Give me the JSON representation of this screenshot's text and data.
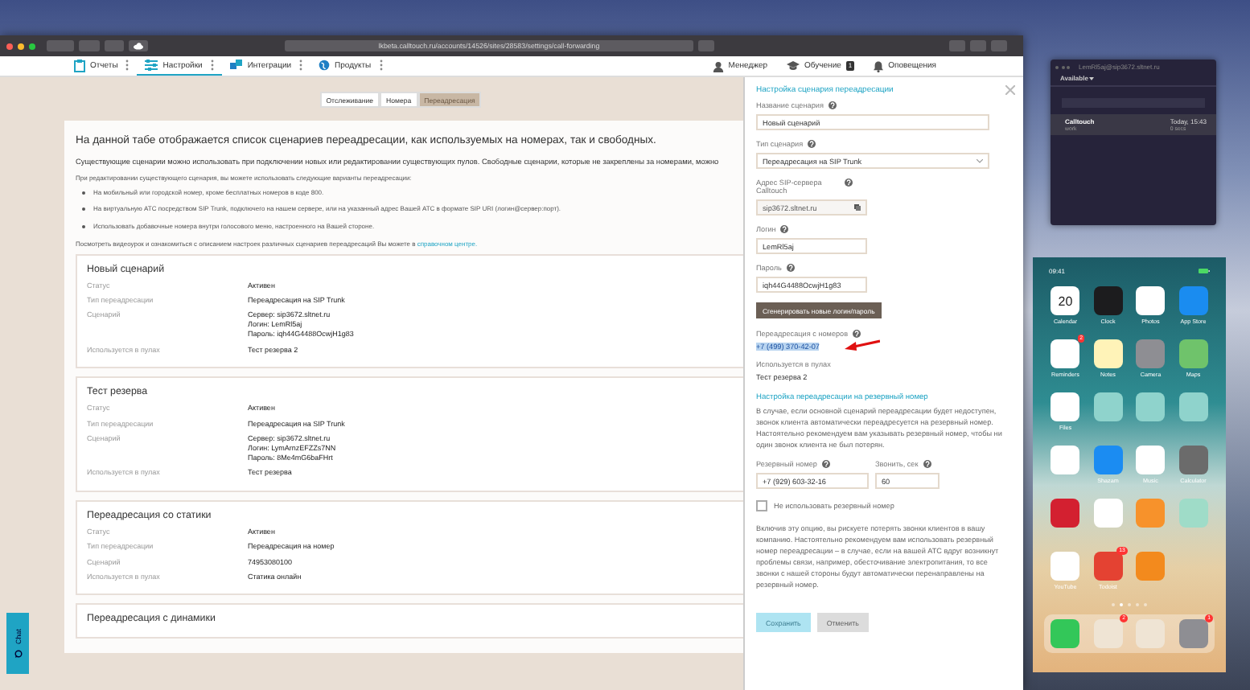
{
  "browser": {
    "url": "lkbeta.calltouch.ru/accounts/14526/sites/28583/settings/call-forwarding"
  },
  "nav": {
    "items": [
      {
        "label": "Отчеты",
        "selected": false
      },
      {
        "label": "Настройки",
        "selected": true
      },
      {
        "label": "Интеграции",
        "selected": false
      },
      {
        "label": "Продукты",
        "selected": false
      }
    ],
    "right": [
      {
        "label": "Менеджер",
        "kind": "manager"
      },
      {
        "label": "Обучение",
        "kind": "learning",
        "badge": "1"
      },
      {
        "label": "Оповещения",
        "kind": "alerts"
      }
    ]
  },
  "subtabs": [
    {
      "label": "Отслеживание",
      "selected": false
    },
    {
      "label": "Номера",
      "selected": false
    },
    {
      "label": "Переадресация",
      "selected": true
    }
  ],
  "intro": {
    "heading": "На данной табе отображается список сценариев переадресации, как используемых на номерах, так и свободных.",
    "paragraph": "Существующие сценарии можно использовать при подключении новых или редактировании существующих пулов. Свободные сценарии, которые не закреплены за номерами, можно",
    "note": "При редактировании существующего сценария, вы можете использовать следующие варианты переадресации:",
    "bullets": [
      "На мобильный или городской номер, кроме бесплатных номеров в коде 800.",
      "На виртуальную АТС посредством SIP Trunk, подключего на нашем сервере, или на указанный адрес Вашей АТС в формате SIP URI (логин@сервер:порт).",
      "Использовать добавочные номера внутри голосового меню, настроенного на Вашей стороне."
    ],
    "footer": "Посмотреть видеоурок и ознакомиться с описанием настроек различных сценариев переадресаций Вы можете в",
    "link": "справочном центре."
  },
  "scenarios": [
    {
      "title": "Новый сценарий",
      "fields": [
        {
          "label": "Статус",
          "value": "Активен"
        },
        {
          "label": "Тип переадресации",
          "value": "Переадресация на SIP Trunk"
        },
        {
          "label": "Сценарий",
          "lines": [
            "Сервер: sip3672.sltnet.ru",
            "Логин: LemRl5aj",
            "Пароль: iqh44G4488OcwjH1g83"
          ]
        },
        {
          "label": "Используется в пулах",
          "value": "Тест резерва 2"
        }
      ]
    },
    {
      "title": "Тест резерва",
      "fields": [
        {
          "label": "Статус",
          "value": "Активен"
        },
        {
          "label": "Тип переадресации",
          "value": "Переадресация на SIP Trunk"
        },
        {
          "label": "Сценарий",
          "lines": [
            "Сервер: sip3672.sltnet.ru",
            "Логин: LymArnzEFZZs7NN",
            "Пароль: 8Me4mG6baFHrt"
          ]
        },
        {
          "label": "Используется в пулах",
          "value": "Тест резерва"
        }
      ]
    },
    {
      "title": "Переадресация со статики",
      "fields": [
        {
          "label": "Статус",
          "value": "Активен"
        },
        {
          "label": "Тип переадресации",
          "value": "Переадресация на номер"
        },
        {
          "label": "Сценарий",
          "value": "74953080100"
        },
        {
          "label": "Используется в пулах",
          "value": "Статика онлайн"
        }
      ]
    },
    {
      "title": "Переадресация с динамики"
    }
  ],
  "chat": {
    "label": "Chat"
  },
  "panel": {
    "title": "Настройка сценария переадресации",
    "name": {
      "label": "Название сценария",
      "value": "Новый сценарий"
    },
    "type": {
      "label": "Тип сценария",
      "value": "Переадресация на SIP Trunk"
    },
    "server": {
      "label": "Адрес SIP-сервера Calltouch",
      "value": "sip3672.sltnet.ru"
    },
    "login": {
      "label": "Логин",
      "value": "LemRl5aj"
    },
    "password": {
      "label": "Пароль",
      "value": "iqh44G4488OcwjH1g83"
    },
    "generate": "Сгенерировать новые логин/пароль",
    "numbers": {
      "label": "Переадресация с номеров",
      "value": "+7 (499) 370-42-07",
      "selected": true
    },
    "pools": {
      "label": "Используется в пулах",
      "value": "Тест резерва 2"
    },
    "backup": {
      "heading": "Настройка переадресации на резервный номер",
      "text": "В случае, если основной сценарий переадресации будет недоступен, звонок клиента автоматически переадресуется на резервный номер. Настоятельно рекомендуем вам указывать резервный номер, чтобы ни один звонок клиента не был потерян.",
      "number": {
        "label": "Резервный номер",
        "value": "+7 (929) 603-32-16"
      },
      "seconds": {
        "label": "Звонить, сек",
        "value": "60"
      },
      "no_backup": {
        "label": "Не использовать резервный номер",
        "checked": false
      },
      "warning": "Включив эту опцию, вы рискуете потерять звонки клиентов в вашу компанию. Настоятельно рекомендуем вам использовать резервный номер переадресации – в случае, если на вашей АТС вдруг возникнут проблемы связи, например, обесточивание электропитания, то все звонки с нашей стороны будут автоматически перенаправлены на резервный номер."
    },
    "buttons": [
      {
        "label": "Сохранить",
        "kind": "primary",
        "disabled": true
      },
      {
        "label": "Отменить",
        "kind": "secondary",
        "disabled": true
      }
    ]
  },
  "softphone": {
    "title": "LemRl5aj@sip3672.sltnet.ru",
    "status": "Available",
    "calls": [
      {
        "name": "Calltouch",
        "type": "work",
        "time": "Today, 15:43",
        "duration": "0 secs"
      }
    ]
  },
  "phone": {
    "time": "09:41",
    "apps": [
      {
        "label": "Calendar",
        "color": "#ffffff",
        "text": "20"
      },
      {
        "label": "Clock",
        "color": "#1c1c1e"
      },
      {
        "label": "Photos",
        "color": "#ffffff"
      },
      {
        "label": "App Store",
        "color": "#1a8cf0"
      },
      {
        "label": "Reminders",
        "color": "#ffffff",
        "badge": "2"
      },
      {
        "label": "Notes",
        "color": "#fff3b8"
      },
      {
        "label": "Camera",
        "color": "#8e8e93"
      },
      {
        "label": "Maps",
        "color": "#6fc36b"
      },
      {
        "label": "Files",
        "color": "#ffffff"
      },
      {
        "color": "#8fd3cc"
      },
      {
        "color": "#8fd3cc"
      },
      {
        "color": "#8fd3cc"
      },
      {
        "color": "#ffffff"
      },
      {
        "label": "Shazam",
        "color": "#1b8cf2"
      },
      {
        "label": "Music",
        "color": "#ffffff"
      },
      {
        "label": "Calculator",
        "color": "#6b6b6b"
      },
      {
        "color": "#d32030"
      },
      {
        "color": "#ffffff"
      },
      {
        "color": "#f7922b"
      },
      {
        "color": "#9fdcc8"
      },
      {
        "label": "YouTube",
        "color": "#ffffff"
      },
      {
        "label": "Todoist",
        "color": "#e44232",
        "badge": "13"
      },
      {
        "color": "#f38a1d"
      }
    ],
    "pages": [
      {
        "selected": false
      },
      {
        "selected": true
      },
      {
        "selected": false
      },
      {
        "selected": false
      },
      {
        "selected": false
      }
    ],
    "dock": [
      {
        "color": "#33c759"
      },
      {
        "color": "#efe4d4",
        "badge": "2"
      },
      {
        "color": "#efe4d4"
      },
      {
        "color": "#8e8e93",
        "badge": "1"
      }
    ]
  }
}
